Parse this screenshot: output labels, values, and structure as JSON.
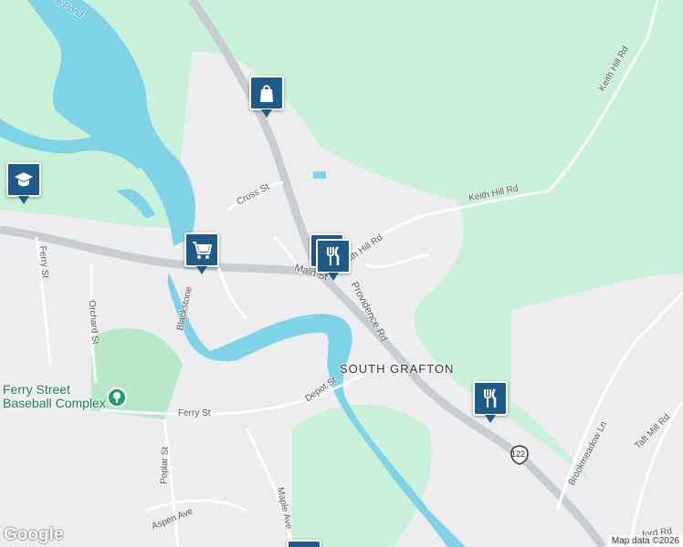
{
  "map": {
    "place_label": "SOUTH GRAFTON",
    "water_labels": [
      {
        "text": "e Pond"
      }
    ],
    "road_labels": {
      "keith_hill_rd_top": "Keith Hill Rd",
      "keith_hill_rd_mid": "Keith Hill Rd",
      "keith_hill_rd_low": "Keith Hill Rd",
      "cross_st": "Cross St",
      "main_st": "Main St",
      "providence_rd": "Providence Rd",
      "ferry_st_vertical": "Ferry St",
      "orchard_st": "Orchard St",
      "blackstone": "Blackstone",
      "depot_st": "Depot St",
      "ferry_st": "Ferry St",
      "poplar_st": "Poplar St",
      "maple_ave": "Maple Ave",
      "aspen_ave": "Aspen Ave",
      "brookmeadow_ln": "Brookmeadow Ln",
      "taft_mill_rd": "Taft Mill Rd",
      "bottom_right_rd": "...ford Rd"
    },
    "route_shield": "122",
    "poi": {
      "name_line1": "Ferry Street",
      "name_line2": "Baseball Complex"
    },
    "pins": [
      {
        "type": "shopping",
        "icon": "shopping-bag-icon"
      },
      {
        "type": "school",
        "icon": "graduation-cap-icon"
      },
      {
        "type": "grocery",
        "icon": "shopping-cart-icon"
      },
      {
        "type": "restaurant",
        "icon": "fork-knife-icon"
      },
      {
        "type": "restaurant",
        "icon": "fork-knife-icon"
      }
    ],
    "logo": "Google",
    "attribution": "Map data ©2026"
  },
  "colors": {
    "land_green": "#c9f0d8",
    "urban": "#ededf0",
    "water": "#7fd3e6",
    "road": "#ffffff",
    "highway": "#c8cdd3",
    "pin": "#1f5b8a",
    "park": "#1a9e72"
  }
}
